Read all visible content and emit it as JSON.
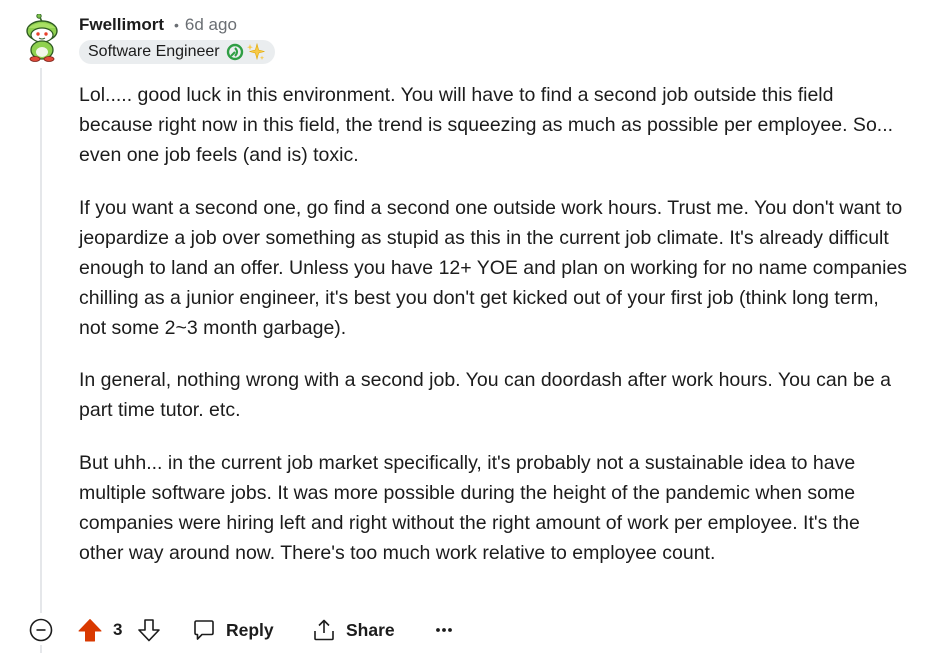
{
  "comment": {
    "username": "Fwellimort",
    "separator": "•",
    "timestamp": "6d ago",
    "flair": {
      "text": "Software Engineer",
      "icons": [
        "leaf-badge-icon",
        "sparkles-icon"
      ]
    },
    "avatar_icon": "snoo-avatar-icon",
    "paragraphs": [
      "Lol..... good luck in this environment. You will have to find a second job outside this field because right now in this field, the trend is squeezing as much as possible per employee. So... even one job feels (and is) toxic.",
      "If you want a second one, go find a second one outside work hours. Trust me. You don't want to jeopardize a job over something as stupid as this in the current job climate. It's already difficult enough to land an offer. Unless you have 12+ YOE and plan on working for no name companies chilling as a junior engineer, it's best you don't get kicked out of your first job (think long term, not some 2~3 month garbage).",
      "In general, nothing wrong with a second job. You can doordash after work hours. You can be a part time tutor. etc.",
      "But uhh... in the current job market specifically, it's probably not a sustainable idea to have multiple software jobs. It was more possible during the height of the pandemic when some companies were hiring left and right without the right amount of work per employee. It's the other way around now. There's too much work relative to employee count."
    ],
    "actions": {
      "vote_count": "3",
      "upvote_active": true,
      "reply_label": "Reply",
      "share_label": "Share",
      "more_icon": "ellipsis-icon",
      "collapse_icon": "collapse-minus-icon"
    },
    "colors": {
      "upvote": "#d93900",
      "text": "#1c1c1c",
      "muted": "#6a6e73",
      "flair_bg": "#eaedef",
      "thread_line": "#e5e7ea"
    }
  }
}
